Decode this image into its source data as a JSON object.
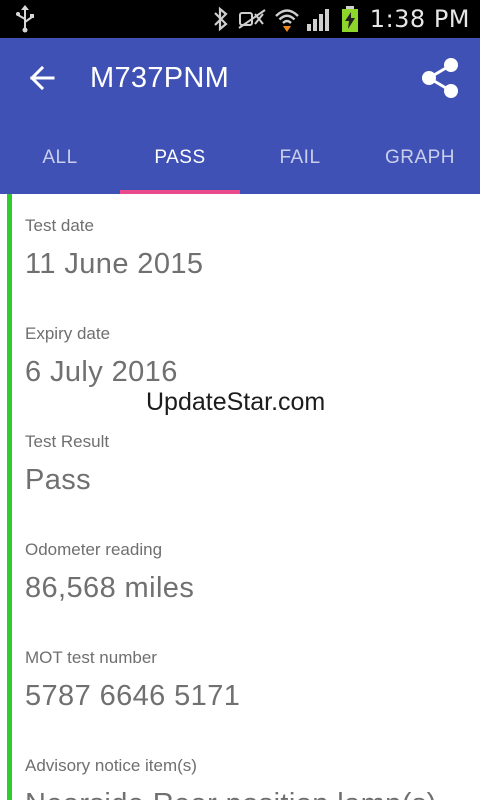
{
  "status_bar": {
    "time": "1:38 PM",
    "icons": [
      "usb-icon",
      "bluetooth-icon",
      "mute-icon",
      "wifi-icon",
      "signal-icon",
      "battery-charging-icon"
    ]
  },
  "toolbar": {
    "title": "M737PNM",
    "back_icon": "arrow-back-icon",
    "share_icon": "share-icon",
    "background_color": "#3f51b5"
  },
  "tabs": [
    {
      "label": "ALL",
      "active": false
    },
    {
      "label": "PASS",
      "active": true
    },
    {
      "label": "FAIL",
      "active": false
    },
    {
      "label": "GRAPH",
      "active": false
    }
  ],
  "tab_indicator_color": "#e84a8b",
  "result_stripe_color": "#2ecc2e",
  "details": [
    {
      "label": "Test date",
      "value": "11 June 2015"
    },
    {
      "label": "Expiry date",
      "value": "6 July 2016"
    },
    {
      "label": "Test Result",
      "value": "Pass"
    },
    {
      "label": "Odometer reading",
      "value": "86,568 miles"
    },
    {
      "label": "MOT test number",
      "value": "5787 6646 5171"
    },
    {
      "label": "Advisory notice item(s)",
      "value": "Nearside Rear position lamp(s)"
    }
  ],
  "watermark": "UpdateStar.com"
}
